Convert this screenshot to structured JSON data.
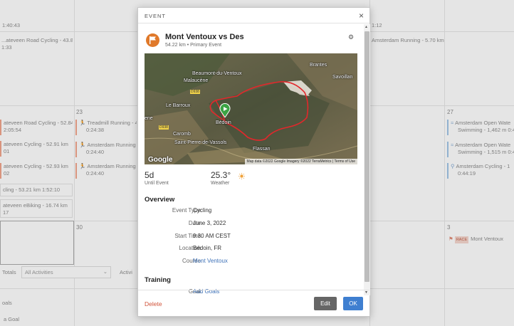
{
  "background": {
    "top_times": [
      "1:40:43",
      "1:12"
    ],
    "top_items": [
      "...ateveen Road Cycling - 43.81",
      "1:33",
      "Amsterdam Running - 5.70 km"
    ],
    "day_numbers": [
      "23",
      "27",
      "30",
      "3"
    ],
    "col0_items": [
      {
        "title": "ateveen Road Cycling - 52.84",
        "sub": "2:05:54"
      },
      {
        "title": "ateveen Cycling - 52.91 km",
        "sub": "01"
      },
      {
        "title": "ateveen Cycling - 52.93 km",
        "sub": "02"
      },
      {
        "title": "cling - 53.21 km 1:52:10",
        "sub": ""
      },
      {
        "title": "ateveen eBiking - 16.74 km",
        "sub": "17"
      }
    ],
    "col1_items": [
      {
        "title": "Treadmill Running - 4",
        "sub": "0:24:38"
      },
      {
        "title": "Amsterdam Running",
        "sub": "0:24:40"
      },
      {
        "title": "Amsterdam Running",
        "sub": "0:24:40"
      }
    ],
    "col3_items": [
      {
        "title": "Amsterdam Open Wate",
        "sub": "Swimming - 1,462 m 0:4"
      },
      {
        "title": "Amsterdam Open Wate",
        "sub": "Swimming - 1,515 m 0:4"
      },
      {
        "title": "Amsterdam Cycling - 1",
        "sub": "0:44:19"
      }
    ],
    "race_badge": "RACE",
    "race_item": "Mont Ventoux",
    "totals_label": "Totals",
    "activities_select": "All Activities",
    "activities_label": "Activi",
    "goals_label": "oals",
    "goal_hint": "a Goal"
  },
  "modal": {
    "header_title": "EVENT",
    "close_icon": "close-icon",
    "event_name": "Mont Ventoux vs Des",
    "event_sub": "54.22 km • Primary Event",
    "map": {
      "labels": [
        "Brantes",
        "Savoillan",
        "Beaumont-du-Ventoux",
        "Malaucène",
        "Le Barroux",
        "Bédoin",
        "Caromb",
        "Saint-Pierre-de-Vassols",
        "Flassan",
        "D938",
        "D938",
        "ene"
      ],
      "google_logo": "Google",
      "attribution": "Map data ©2022 Google Imagery ©2022 TerraMetrics | Terms of Use"
    },
    "stats": {
      "until_value": "5d",
      "until_label": "Until Event",
      "weather_value": "25.3°",
      "weather_label": "Weather"
    },
    "overview": {
      "heading": "Overview",
      "rows": [
        {
          "label": "Event Type:",
          "value": "Cycling"
        },
        {
          "label": "Date:",
          "value": "June 3, 2022"
        },
        {
          "label": "Start Time:",
          "value": "9:30 AM CEST"
        },
        {
          "label": "Location:",
          "value": "Bédoin, FR"
        },
        {
          "label": "Course:",
          "value": "Mont Ventoux"
        }
      ]
    },
    "training": {
      "heading": "Training",
      "goal_label": "Goal:",
      "goal_link": "Add Goals"
    },
    "footer": {
      "delete_label": "Delete",
      "edit_label": "Edit",
      "ok_label": "OK"
    },
    "colors": {
      "accent": "#3f7fd0",
      "event_icon": "#e0792a",
      "route": "#e3272b",
      "delete": "#d0533a"
    }
  }
}
